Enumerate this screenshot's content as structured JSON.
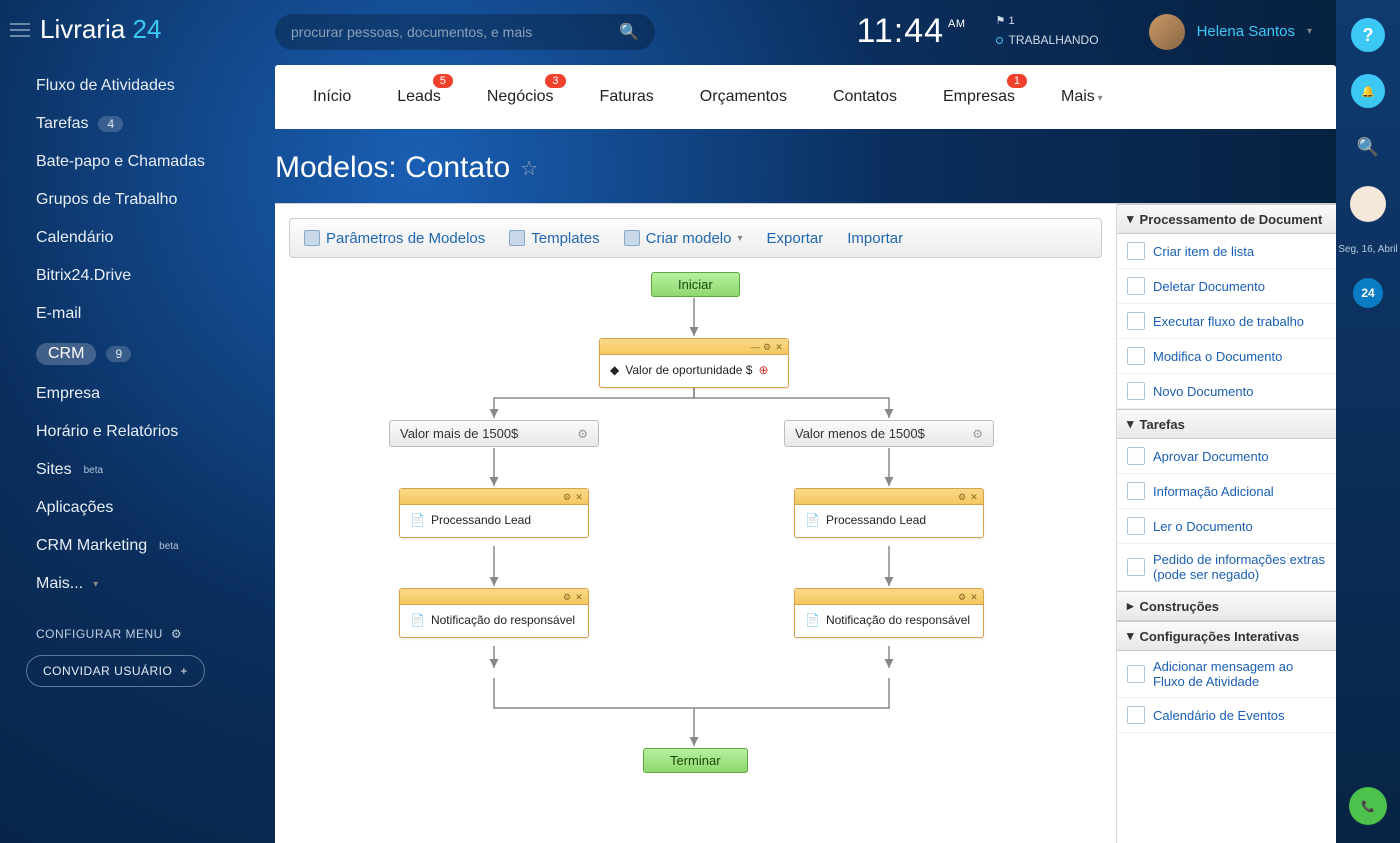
{
  "brand": {
    "name": "Livraria",
    "suffix": "24"
  },
  "search": {
    "placeholder": "procurar pessoas, documentos, e mais"
  },
  "clock": {
    "time": "11:44",
    "ampm": "AM"
  },
  "status": {
    "flag_count": "1",
    "state": "TRABALHANDO"
  },
  "user": {
    "name": "Helena Santos"
  },
  "sidebar": {
    "items": [
      {
        "label": "Fluxo de Atividades"
      },
      {
        "label": "Tarefas",
        "count": "4"
      },
      {
        "label": "Bate-papo e Chamadas"
      },
      {
        "label": "Grupos de Trabalho"
      },
      {
        "label": "Calendário"
      },
      {
        "label": "Bitrix24.Drive"
      },
      {
        "label": "E-mail"
      },
      {
        "label": "CRM",
        "count": "9",
        "active": true
      },
      {
        "label": "Empresa"
      },
      {
        "label": "Horário e Relatórios"
      },
      {
        "label": "Sites",
        "beta": "beta"
      },
      {
        "label": "Aplicações"
      },
      {
        "label": "CRM Marketing",
        "beta": "beta"
      },
      {
        "label": "Mais..."
      }
    ],
    "config": "CONFIGURAR MENU",
    "invite": "CONVIDAR USUÁRIO"
  },
  "tabs": [
    {
      "label": "Início"
    },
    {
      "label": "Leads",
      "badge": "5"
    },
    {
      "label": "Negócios",
      "badge": "3"
    },
    {
      "label": "Faturas"
    },
    {
      "label": "Orçamentos"
    },
    {
      "label": "Contatos"
    },
    {
      "label": "Empresas",
      "badge": "1"
    },
    {
      "label": "Mais"
    }
  ],
  "page_title": "Modelos: Contato",
  "toolbar": {
    "params": "Parâmetros de Modelos",
    "templates": "Templates",
    "create": "Criar modelo",
    "export": "Exportar",
    "import": "Importar"
  },
  "flow": {
    "start": "Iniciar",
    "opportunity": "Valor de oportunidade $",
    "cond_left": "Valor mais de 1500$",
    "cond_right": "Valor menos de 1500$",
    "process_left": "Processando Lead",
    "process_right": "Processando Lead",
    "notify_left": "Notificação do responsável",
    "notify_right": "Notificação do responsável",
    "end": "Terminar"
  },
  "rightpanel": {
    "sections": [
      {
        "title": "Processamento de Document",
        "items": [
          "Criar item de lista",
          "Deletar Documento",
          "Executar fluxo de trabalho",
          "Modifica o Documento",
          "Novo Documento"
        ]
      },
      {
        "title": "Tarefas",
        "items": [
          "Aprovar Documento",
          "Informação Adicional",
          "Ler o Documento",
          "Pedido de informações extras (pode ser negado)"
        ]
      },
      {
        "title": "Construções",
        "items": []
      },
      {
        "title": "Configurações Interativas",
        "items": [
          "Adicionar mensagem ao Fluxo de Atividade",
          "Calendário de Eventos"
        ]
      }
    ]
  },
  "rail": {
    "date": "Seg, 16, Abril",
    "logo": "24"
  }
}
